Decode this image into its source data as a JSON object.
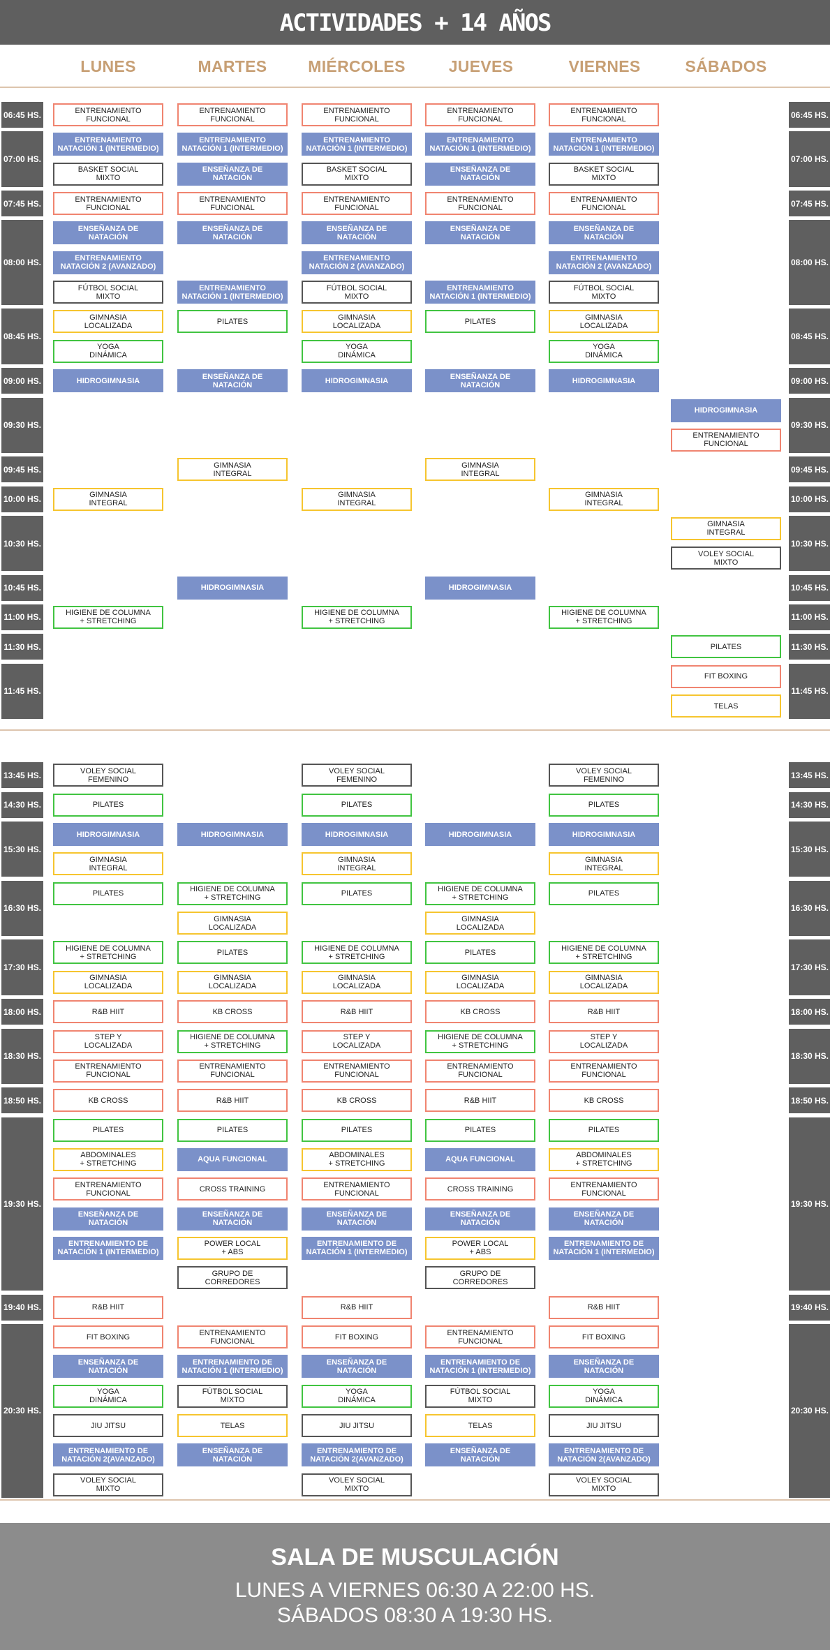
{
  "title": "ACTIVIDADES + 14 AÑOS",
  "colors": {
    "header_bg": "#5f5f5f",
    "day_text": "#c79f74",
    "blue": "#7b91c9",
    "red": "#f08470",
    "green": "#41c441",
    "yellow": "#f6c52f",
    "gray": "#555555",
    "footer_bg": "#8c8c8c"
  },
  "days": [
    "LUNES",
    "MARTES",
    "MIÉRCOLES",
    "JUEVES",
    "VIERNES",
    "SÁBADOS"
  ],
  "times": [
    {
      "label": "06:45 HS.",
      "slots": [
        [
          "ENTRENAMIENTO\nFUNCIONAL|red",
          "ENTRENAMIENTO\nFUNCIONAL|red",
          "ENTRENAMIENTO\nFUNCIONAL|red",
          "ENTRENAMIENTO\nFUNCIONAL|red",
          "ENTRENAMIENTO\nFUNCIONAL|red",
          ""
        ]
      ]
    },
    {
      "label": "07:00 HS.",
      "slots": [
        [
          "ENTRENAMIENTO\nNATACIÓN 1 (INTERMEDIO)|blue",
          "ENTRENAMIENTO\nNATACIÓN 1 (INTERMEDIO)|blue",
          "ENTRENAMIENTO\nNATACIÓN 1 (INTERMEDIO)|blue",
          "ENTRENAMIENTO\nNATACIÓN 1 (INTERMEDIO)|blue",
          "ENTRENAMIENTO\nNATACIÓN 1 (INTERMEDIO)|blue",
          ""
        ],
        [
          "BASKET SOCIAL\nMIXTO|gray",
          "ENSEÑANZA DE\nNATACIÓN|blue",
          "BASKET SOCIAL\nMIXTO|gray",
          "ENSEÑANZA DE\nNATACIÓN|blue",
          "BASKET SOCIAL\nMIXTO|gray",
          ""
        ]
      ]
    },
    {
      "label": "07:45 HS.",
      "slots": [
        [
          "ENTRENAMIENTO\nFUNCIONAL|red",
          "ENTRENAMIENTO\nFUNCIONAL|red",
          "ENTRENAMIENTO\nFUNCIONAL|red",
          "ENTRENAMIENTO\nFUNCIONAL|red",
          "ENTRENAMIENTO\nFUNCIONAL|red",
          ""
        ]
      ]
    },
    {
      "label": "08:00 HS.",
      "slots": [
        [
          "ENSEÑANZA DE\nNATACIÓN|blue",
          "ENSEÑANZA DE\nNATACIÓN|blue",
          "ENSEÑANZA DE\nNATACIÓN|blue",
          "ENSEÑANZA DE\nNATACIÓN|blue",
          "ENSEÑANZA DE\nNATACIÓN|blue",
          ""
        ],
        [
          "ENTRENAMIENTO\nNATACIÓN 2 (AVANZADO)|blue",
          "",
          "ENTRENAMIENTO\nNATACIÓN 2 (AVANZADO)|blue",
          "",
          "ENTRENAMIENTO\nNATACIÓN 2 (AVANZADO)|blue",
          ""
        ],
        [
          "FÚTBOL SOCIAL\nMIXTO|gray",
          "ENTRENAMIENTO\nNATACIÓN 1 (INTERMEDIO)|blue",
          "FÚTBOL SOCIAL\nMIXTO|gray",
          "ENTRENAMIENTO\nNATACIÓN 1 (INTERMEDIO)|blue",
          "FÚTBOL SOCIAL\nMIXTO|gray",
          ""
        ]
      ]
    },
    {
      "label": "08:45 HS.",
      "slots": [
        [
          "GIMNASIA\nLOCALIZADA|yellow",
          "PILATES|green",
          "GIMNASIA\nLOCALIZADA|yellow",
          "PILATES|green",
          "GIMNASIA\nLOCALIZADA|yellow",
          ""
        ],
        [
          "YOGA\nDINÁMICA|green",
          "",
          "YOGA\nDINÁMICA|green",
          "",
          "YOGA\nDINÁMICA|green",
          ""
        ]
      ]
    },
    {
      "label": "09:00 HS.",
      "slots": [
        [
          "HIDROGIMNASIA|blue",
          "ENSEÑANZA DE\nNATACIÓN|blue",
          "HIDROGIMNASIA|blue",
          "ENSEÑANZA DE\nNATACIÓN|blue",
          "HIDROGIMNASIA|blue",
          ""
        ]
      ]
    },
    {
      "label": "09:30 HS.",
      "slots": [
        [
          "",
          "",
          "",
          "",
          "",
          "HIDROGIMNASIA|blue"
        ],
        [
          "",
          "",
          "",
          "",
          "",
          "ENTRENAMIENTO\nFUNCIONAL|red"
        ]
      ]
    },
    {
      "label": "09:45 HS.",
      "slots": [
        [
          "",
          "GIMNASIA\nINTEGRAL|yellow",
          "",
          "GIMNASIA\nINTEGRAL|yellow",
          "",
          ""
        ]
      ]
    },
    {
      "label": "10:00 HS.",
      "slots": [
        [
          "GIMNASIA\nINTEGRAL|yellow",
          "",
          "GIMNASIA\nINTEGRAL|yellow",
          "",
          "GIMNASIA\nINTEGRAL|yellow",
          ""
        ]
      ]
    },
    {
      "label": "10:30 HS.",
      "slots": [
        [
          "",
          "",
          "",
          "",
          "",
          "GIMNASIA\nINTEGRAL|yellow"
        ],
        [
          "",
          "",
          "",
          "",
          "",
          "VOLEY SOCIAL\nMIXTO|gray"
        ]
      ]
    },
    {
      "label": "10:45 HS.",
      "slots": [
        [
          "",
          "HIDROGIMNASIA|blue",
          "",
          "HIDROGIMNASIA|blue",
          "",
          ""
        ]
      ]
    },
    {
      "label": "11:00 HS.",
      "slots": [
        [
          "HIGIENE DE COLUMNA\n+ STRETCHING|green",
          "",
          "HIGIENE DE COLUMNA\n+ STRETCHING|green",
          "",
          "HIGIENE DE COLUMNA\n+ STRETCHING|green",
          ""
        ]
      ]
    },
    {
      "label": "11:30 HS.",
      "slots": [
        [
          "",
          "",
          "",
          "",
          "",
          "PILATES|green"
        ]
      ]
    },
    {
      "label": "11:45 HS.",
      "slots": [
        [
          "",
          "",
          "",
          "",
          "",
          "FIT BOXING|red"
        ],
        [
          "",
          "",
          "",
          "",
          "",
          "TELAS|yellow"
        ]
      ]
    },
    {
      "label": "13:45 HS.",
      "slots": [
        [
          "VOLEY SOCIAL\nFEMENINO|gray",
          "",
          "VOLEY SOCIAL\nFEMENINO|gray",
          "",
          "VOLEY SOCIAL\nFEMENINO|gray",
          ""
        ]
      ]
    },
    {
      "label": "14:30 HS.",
      "slots": [
        [
          "PILATES|green",
          "",
          "PILATES|green",
          "",
          "PILATES|green",
          ""
        ]
      ]
    },
    {
      "label": "15:30 HS.",
      "slots": [
        [
          "HIDROGIMNASIA|blue",
          "HIDROGIMNASIA|blue",
          "HIDROGIMNASIA|blue",
          "HIDROGIMNASIA|blue",
          "HIDROGIMNASIA|blue",
          ""
        ],
        [
          "GIMNASIA\nINTEGRAL|yellow",
          "",
          "GIMNASIA\nINTEGRAL|yellow",
          "",
          "GIMNASIA\nINTEGRAL|yellow",
          ""
        ]
      ]
    },
    {
      "label": "16:30 HS.",
      "slots": [
        [
          "PILATES|green",
          "HIGIENE DE COLUMNA\n+ STRETCHING|green",
          "PILATES|green",
          "HIGIENE DE COLUMNA\n+ STRETCHING|green",
          "PILATES|green",
          ""
        ],
        [
          "",
          "GIMNASIA\nLOCALIZADA|yellow",
          "",
          "GIMNASIA\nLOCALIZADA|yellow",
          "",
          ""
        ]
      ]
    },
    {
      "label": "17:30 HS.",
      "slots": [
        [
          "HIGIENE DE COLUMNA\n+ STRETCHING|green",
          "PILATES|green",
          "HIGIENE DE COLUMNA\n+ STRETCHING|green",
          "PILATES|green",
          "HIGIENE DE COLUMNA\n+ STRETCHING|green",
          ""
        ],
        [
          "GIMNASIA\nLOCALIZADA|yellow",
          "GIMNASIA\nLOCALIZADA|yellow",
          "GIMNASIA\nLOCALIZADA|yellow",
          "GIMNASIA\nLOCALIZADA|yellow",
          "GIMNASIA\nLOCALIZADA|yellow",
          ""
        ]
      ]
    },
    {
      "label": "18:00 HS.",
      "slots": [
        [
          "R&B HIIT|red",
          "KB CROSS|red",
          "R&B HIIT|red",
          "KB CROSS|red",
          "R&B HIIT|red",
          ""
        ]
      ]
    },
    {
      "label": "18:30 HS.",
      "slots": [
        [
          "STEP Y\nLOCALIZADA|red",
          "HIGIENE DE COLUMNA\n+ STRETCHING|green",
          "STEP Y\nLOCALIZADA|red",
          "HIGIENE DE COLUMNA\n+ STRETCHING|green",
          "STEP Y\nLOCALIZADA|red",
          ""
        ],
        [
          "ENTRENAMIENTO\nFUNCIONAL|red",
          "ENTRENAMIENTO\nFUNCIONAL|red",
          "ENTRENAMIENTO\nFUNCIONAL|red",
          "ENTRENAMIENTO\nFUNCIONAL|red",
          "ENTRENAMIENTO\nFUNCIONAL|red",
          ""
        ]
      ]
    },
    {
      "label": "18:50 HS.",
      "slots": [
        [
          "KB CROSS|red",
          "R&B HIIT|red",
          "KB CROSS|red",
          "R&B HIIT|red",
          "KB CROSS|red",
          ""
        ]
      ]
    },
    {
      "label": "19:30 HS.",
      "slots": [
        [
          "PILATES|green",
          "PILATES|green",
          "PILATES|green",
          "PILATES|green",
          "PILATES|green",
          ""
        ],
        [
          "ABDOMINALES\n+ STRETCHING|yellow",
          "AQUA FUNCIONAL|blue",
          "ABDOMINALES\n+ STRETCHING|yellow",
          "AQUA FUNCIONAL|blue",
          "ABDOMINALES\n+ STRETCHING|yellow",
          ""
        ],
        [
          "ENTRENAMIENTO\nFUNCIONAL|red",
          "CROSS TRAINING|red",
          "ENTRENAMIENTO\nFUNCIONAL|red",
          "CROSS TRAINING|red",
          "ENTRENAMIENTO\nFUNCIONAL|red",
          ""
        ],
        [
          "ENSEÑANZA DE\nNATACIÓN|blue",
          "ENSEÑANZA DE\nNATACIÓN|blue",
          "ENSEÑANZA DE\nNATACIÓN|blue",
          "ENSEÑANZA DE\nNATACIÓN|blue",
          "ENSEÑANZA DE\nNATACIÓN|blue",
          ""
        ],
        [
          "ENTRENAMIENTO DE\nNATACIÓN 1 (INTERMEDIO)|blue",
          "POWER LOCAL\n+ ABS|yellow",
          "ENTRENAMIENTO DE\nNATACIÓN 1 (INTERMEDIO)|blue",
          "POWER LOCAL\n+ ABS|yellow",
          "ENTRENAMIENTO DE\nNATACIÓN 1 (INTERMEDIO)|blue",
          ""
        ],
        [
          "",
          "GRUPO DE\nCORREDORES|gray",
          "",
          "GRUPO DE\nCORREDORES|gray",
          "",
          ""
        ]
      ]
    },
    {
      "label": "19:40 HS.",
      "slots": [
        [
          "R&B HIIT|red",
          "",
          "R&B HIIT|red",
          "",
          "R&B HIIT|red",
          ""
        ]
      ]
    },
    {
      "label": "20:30 HS.",
      "slots": [
        [
          "FIT BOXING|red",
          "ENTRENAMIENTO\nFUNCIONAL|red",
          "FIT BOXING|red",
          "ENTRENAMIENTO\nFUNCIONAL|red",
          "FIT BOXING|red",
          ""
        ],
        [
          "ENSEÑANZA DE\nNATACIÓN|blue",
          "ENTRENAMIENTO DE\nNATACIÓN 1 (INTERMEDIO)|blue",
          "ENSEÑANZA DE\nNATACIÓN|blue",
          "ENTRENAMIENTO DE\nNATACIÓN 1 (INTERMEDIO)|blue",
          "ENSEÑANZA DE\nNATACIÓN|blue",
          ""
        ],
        [
          "YOGA\nDINÁMICA|green",
          "FÚTBOL SOCIAL\nMIXTO|gray",
          "YOGA\nDINÁMICA|green",
          "FÚTBOL SOCIAL\nMIXTO|gray",
          "YOGA\nDINÁMICA|green",
          ""
        ],
        [
          "JIU JITSU|gray",
          "TELAS|yellow",
          "JIU JITSU|gray",
          "TELAS|yellow",
          "JIU JITSU|gray",
          ""
        ],
        [
          "ENTRENAMIENTO DE\nNATACIÓN 2(AVANZADO)|blue",
          "ENSEÑANZA DE\nNATACIÓN|blue",
          "ENTRENAMIENTO DE\nNATACIÓN 2(AVANZADO)|blue",
          "ENSEÑANZA DE\nNATACIÓN|blue",
          "ENTRENAMIENTO DE\nNATACIÓN 2(AVANZADO)|blue",
          ""
        ],
        [
          "VOLEY SOCIAL\nMIXTO|gray",
          "",
          "VOLEY SOCIAL\nMIXTO|gray",
          "",
          "VOLEY SOCIAL\nMIXTO|gray",
          ""
        ]
      ]
    }
  ],
  "footer": {
    "title": "SALA DE MUSCULACIÓN",
    "line1": "LUNES A VIERNES 06:30 A 22:00 HS.",
    "line2": "SÁBADOS 08:30 A 19:30 HS."
  }
}
